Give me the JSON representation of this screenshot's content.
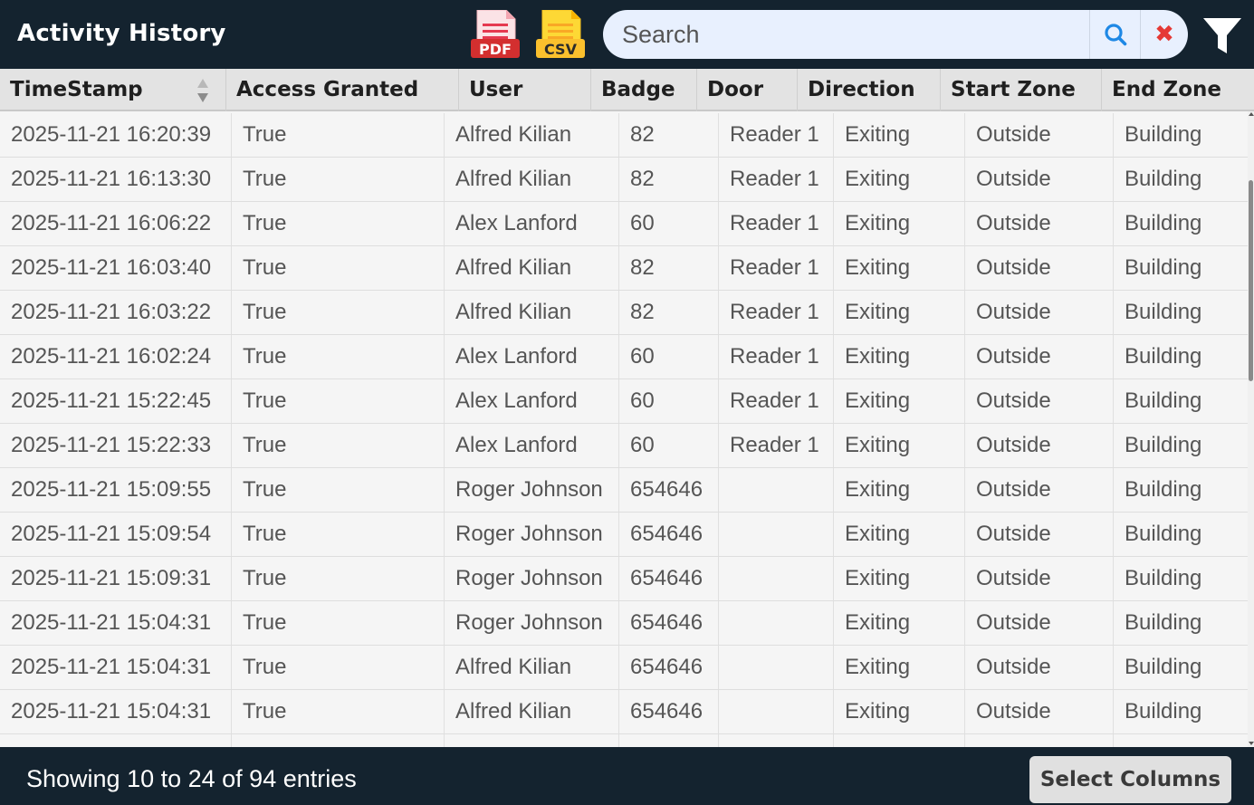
{
  "header": {
    "title": "Activity History",
    "pdf_label": "PDF",
    "csv_label": "CSV",
    "search_placeholder": "Search",
    "search_value": "",
    "clear_label": "✖"
  },
  "table": {
    "columns": [
      "TimeStamp",
      "Access Granted",
      "User",
      "Badge",
      "Door",
      "Direction",
      "Start Zone",
      "End Zone"
    ],
    "rows": [
      [
        "2025-11-21 16:20:39",
        "True",
        "Alfred Kilian",
        "82",
        "Reader 1",
        "Exiting",
        "Outside",
        "Building"
      ],
      [
        "2025-11-21 16:13:30",
        "True",
        "Alfred Kilian",
        "82",
        "Reader 1",
        "Exiting",
        "Outside",
        "Building"
      ],
      [
        "2025-11-21 16:06:22",
        "True",
        "Alex Lanford",
        "60",
        "Reader 1",
        "Exiting",
        "Outside",
        "Building"
      ],
      [
        "2025-11-21 16:03:40",
        "True",
        "Alfred Kilian",
        "82",
        "Reader 1",
        "Exiting",
        "Outside",
        "Building"
      ],
      [
        "2025-11-21 16:03:22",
        "True",
        "Alfred Kilian",
        "82",
        "Reader 1",
        "Exiting",
        "Outside",
        "Building"
      ],
      [
        "2025-11-21 16:02:24",
        "True",
        "Alex Lanford",
        "60",
        "Reader 1",
        "Exiting",
        "Outside",
        "Building"
      ],
      [
        "2025-11-21 15:22:45",
        "True",
        "Alex Lanford",
        "60",
        "Reader 1",
        "Exiting",
        "Outside",
        "Building"
      ],
      [
        "2025-11-21 15:22:33",
        "True",
        "Alex Lanford",
        "60",
        "Reader 1",
        "Exiting",
        "Outside",
        "Building"
      ],
      [
        "2025-11-21 15:09:55",
        "True",
        "Roger Johnson",
        "654646",
        "",
        "Exiting",
        "Outside",
        "Building"
      ],
      [
        "2025-11-21 15:09:54",
        "True",
        "Roger Johnson",
        "654646",
        "",
        "Exiting",
        "Outside",
        "Building"
      ],
      [
        "2025-11-21 15:09:31",
        "True",
        "Roger Johnson",
        "654646",
        "",
        "Exiting",
        "Outside",
        "Building"
      ],
      [
        "2025-11-21 15:04:31",
        "True",
        "Roger Johnson",
        "654646",
        "",
        "Exiting",
        "Outside",
        "Building"
      ],
      [
        "2025-11-21 15:04:31",
        "True",
        "Alfred Kilian",
        "654646",
        "",
        "Exiting",
        "Outside",
        "Building"
      ],
      [
        "2025-11-21 15:04:31",
        "True",
        "Alfred Kilian",
        "654646",
        "",
        "Exiting",
        "Outside",
        "Building"
      ],
      [
        "",
        "",
        "",
        "",
        "",
        "",
        "",
        ""
      ]
    ]
  },
  "footer": {
    "info": "Showing 10 to 24 of 94 entries",
    "select_columns_label": "Select Columns"
  },
  "icons": {
    "pdf": "pdf-file-icon",
    "csv": "csv-file-icon",
    "search": "search-icon",
    "clear": "close-icon",
    "filter": "filter-icon",
    "sort": "sort-icon"
  },
  "colors": {
    "bar_background": "#14232f",
    "search_background": "#e8f0fe",
    "search_icon": "#1e88e5",
    "clear_icon": "#e53935",
    "pdf": "#e53935",
    "csv": "#fdd835"
  }
}
